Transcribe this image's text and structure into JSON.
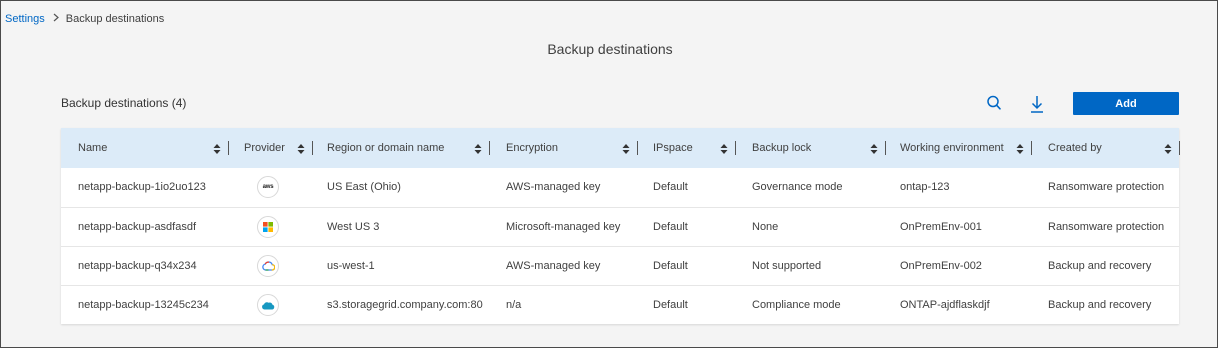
{
  "breadcrumb": {
    "parent": "Settings",
    "current": "Backup destinations"
  },
  "page_title": "Backup destinations",
  "section_title": "Backup destinations (4)",
  "toolbar": {
    "search_icon": "search-icon",
    "download_icon": "download-icon",
    "add_label": "Add"
  },
  "colors": {
    "accent": "#0067c5",
    "header_bg": "#dcebf8",
    "page_bg": "#f4f4f4"
  },
  "table": {
    "columns": [
      "Name",
      "Provider",
      "Region or domain name",
      "Encryption",
      "IPspace",
      "Backup lock",
      "Working environment",
      "Created by"
    ],
    "rows": [
      {
        "name": "netapp-backup-1io2uo123",
        "provider": "aws",
        "provider_icon": "aws-logo-icon",
        "provider_label": "aws",
        "region": "US East (Ohio)",
        "encryption": "AWS-managed key",
        "ipspace": "Default",
        "backup_lock": "Governance mode",
        "working_environment": "ontap-123",
        "created_by": "Ransomware protection"
      },
      {
        "name": "netapp-backup-asdfasdf",
        "provider": "azure",
        "provider_icon": "microsoft-logo-icon",
        "region": "West US 3",
        "encryption": "Microsoft-managed key",
        "ipspace": "Default",
        "backup_lock": "None",
        "working_environment": "OnPremEnv-001",
        "created_by": "Ransomware protection"
      },
      {
        "name": "netapp-backup-q34x234",
        "provider": "gcp",
        "provider_icon": "google-cloud-logo-icon",
        "region": "us-west-1",
        "encryption": "AWS-managed key",
        "ipspace": "Default",
        "backup_lock": "Not supported",
        "working_environment": "OnPremEnv-002",
        "created_by": "Backup and recovery"
      },
      {
        "name": "netapp-backup-13245c234",
        "provider": "storagegrid",
        "provider_icon": "storagegrid-cloud-icon",
        "region": "s3.storagegrid.company.com:80",
        "encryption": "n/a",
        "ipspace": "Default",
        "backup_lock": "Compliance mode",
        "working_environment": "ONTAP-ajdflaskdjf",
        "created_by": "Backup and recovery"
      }
    ]
  }
}
